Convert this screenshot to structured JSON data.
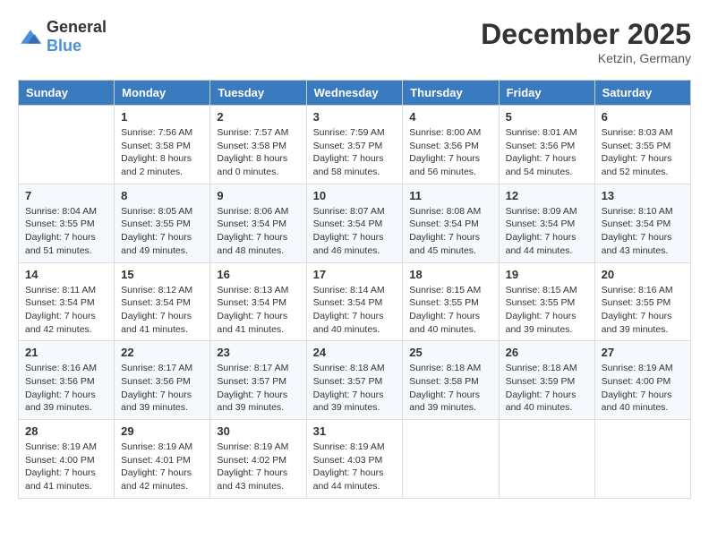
{
  "logo": {
    "text_general": "General",
    "text_blue": "Blue"
  },
  "header": {
    "month": "December 2025",
    "location": "Ketzin, Germany"
  },
  "weekdays": [
    "Sunday",
    "Monday",
    "Tuesday",
    "Wednesday",
    "Thursday",
    "Friday",
    "Saturday"
  ],
  "weeks": [
    [
      {
        "day": "",
        "sunrise": "",
        "sunset": "",
        "daylight": ""
      },
      {
        "day": "1",
        "sunrise": "Sunrise: 7:56 AM",
        "sunset": "Sunset: 3:58 PM",
        "daylight": "Daylight: 8 hours and 2 minutes."
      },
      {
        "day": "2",
        "sunrise": "Sunrise: 7:57 AM",
        "sunset": "Sunset: 3:58 PM",
        "daylight": "Daylight: 8 hours and 0 minutes."
      },
      {
        "day": "3",
        "sunrise": "Sunrise: 7:59 AM",
        "sunset": "Sunset: 3:57 PM",
        "daylight": "Daylight: 7 hours and 58 minutes."
      },
      {
        "day": "4",
        "sunrise": "Sunrise: 8:00 AM",
        "sunset": "Sunset: 3:56 PM",
        "daylight": "Daylight: 7 hours and 56 minutes."
      },
      {
        "day": "5",
        "sunrise": "Sunrise: 8:01 AM",
        "sunset": "Sunset: 3:56 PM",
        "daylight": "Daylight: 7 hours and 54 minutes."
      },
      {
        "day": "6",
        "sunrise": "Sunrise: 8:03 AM",
        "sunset": "Sunset: 3:55 PM",
        "daylight": "Daylight: 7 hours and 52 minutes."
      }
    ],
    [
      {
        "day": "7",
        "sunrise": "Sunrise: 8:04 AM",
        "sunset": "Sunset: 3:55 PM",
        "daylight": "Daylight: 7 hours and 51 minutes."
      },
      {
        "day": "8",
        "sunrise": "Sunrise: 8:05 AM",
        "sunset": "Sunset: 3:55 PM",
        "daylight": "Daylight: 7 hours and 49 minutes."
      },
      {
        "day": "9",
        "sunrise": "Sunrise: 8:06 AM",
        "sunset": "Sunset: 3:54 PM",
        "daylight": "Daylight: 7 hours and 48 minutes."
      },
      {
        "day": "10",
        "sunrise": "Sunrise: 8:07 AM",
        "sunset": "Sunset: 3:54 PM",
        "daylight": "Daylight: 7 hours and 46 minutes."
      },
      {
        "day": "11",
        "sunrise": "Sunrise: 8:08 AM",
        "sunset": "Sunset: 3:54 PM",
        "daylight": "Daylight: 7 hours and 45 minutes."
      },
      {
        "day": "12",
        "sunrise": "Sunrise: 8:09 AM",
        "sunset": "Sunset: 3:54 PM",
        "daylight": "Daylight: 7 hours and 44 minutes."
      },
      {
        "day": "13",
        "sunrise": "Sunrise: 8:10 AM",
        "sunset": "Sunset: 3:54 PM",
        "daylight": "Daylight: 7 hours and 43 minutes."
      }
    ],
    [
      {
        "day": "14",
        "sunrise": "Sunrise: 8:11 AM",
        "sunset": "Sunset: 3:54 PM",
        "daylight": "Daylight: 7 hours and 42 minutes."
      },
      {
        "day": "15",
        "sunrise": "Sunrise: 8:12 AM",
        "sunset": "Sunset: 3:54 PM",
        "daylight": "Daylight: 7 hours and 41 minutes."
      },
      {
        "day": "16",
        "sunrise": "Sunrise: 8:13 AM",
        "sunset": "Sunset: 3:54 PM",
        "daylight": "Daylight: 7 hours and 41 minutes."
      },
      {
        "day": "17",
        "sunrise": "Sunrise: 8:14 AM",
        "sunset": "Sunset: 3:54 PM",
        "daylight": "Daylight: 7 hours and 40 minutes."
      },
      {
        "day": "18",
        "sunrise": "Sunrise: 8:15 AM",
        "sunset": "Sunset: 3:55 PM",
        "daylight": "Daylight: 7 hours and 40 minutes."
      },
      {
        "day": "19",
        "sunrise": "Sunrise: 8:15 AM",
        "sunset": "Sunset: 3:55 PM",
        "daylight": "Daylight: 7 hours and 39 minutes."
      },
      {
        "day": "20",
        "sunrise": "Sunrise: 8:16 AM",
        "sunset": "Sunset: 3:55 PM",
        "daylight": "Daylight: 7 hours and 39 minutes."
      }
    ],
    [
      {
        "day": "21",
        "sunrise": "Sunrise: 8:16 AM",
        "sunset": "Sunset: 3:56 PM",
        "daylight": "Daylight: 7 hours and 39 minutes."
      },
      {
        "day": "22",
        "sunrise": "Sunrise: 8:17 AM",
        "sunset": "Sunset: 3:56 PM",
        "daylight": "Daylight: 7 hours and 39 minutes."
      },
      {
        "day": "23",
        "sunrise": "Sunrise: 8:17 AM",
        "sunset": "Sunset: 3:57 PM",
        "daylight": "Daylight: 7 hours and 39 minutes."
      },
      {
        "day": "24",
        "sunrise": "Sunrise: 8:18 AM",
        "sunset": "Sunset: 3:57 PM",
        "daylight": "Daylight: 7 hours and 39 minutes."
      },
      {
        "day": "25",
        "sunrise": "Sunrise: 8:18 AM",
        "sunset": "Sunset: 3:58 PM",
        "daylight": "Daylight: 7 hours and 39 minutes."
      },
      {
        "day": "26",
        "sunrise": "Sunrise: 8:18 AM",
        "sunset": "Sunset: 3:59 PM",
        "daylight": "Daylight: 7 hours and 40 minutes."
      },
      {
        "day": "27",
        "sunrise": "Sunrise: 8:19 AM",
        "sunset": "Sunset: 4:00 PM",
        "daylight": "Daylight: 7 hours and 40 minutes."
      }
    ],
    [
      {
        "day": "28",
        "sunrise": "Sunrise: 8:19 AM",
        "sunset": "Sunset: 4:00 PM",
        "daylight": "Daylight: 7 hours and 41 minutes."
      },
      {
        "day": "29",
        "sunrise": "Sunrise: 8:19 AM",
        "sunset": "Sunset: 4:01 PM",
        "daylight": "Daylight: 7 hours and 42 minutes."
      },
      {
        "day": "30",
        "sunrise": "Sunrise: 8:19 AM",
        "sunset": "Sunset: 4:02 PM",
        "daylight": "Daylight: 7 hours and 43 minutes."
      },
      {
        "day": "31",
        "sunrise": "Sunrise: 8:19 AM",
        "sunset": "Sunset: 4:03 PM",
        "daylight": "Daylight: 7 hours and 44 minutes."
      },
      {
        "day": "",
        "sunrise": "",
        "sunset": "",
        "daylight": ""
      },
      {
        "day": "",
        "sunrise": "",
        "sunset": "",
        "daylight": ""
      },
      {
        "day": "",
        "sunrise": "",
        "sunset": "",
        "daylight": ""
      }
    ]
  ]
}
